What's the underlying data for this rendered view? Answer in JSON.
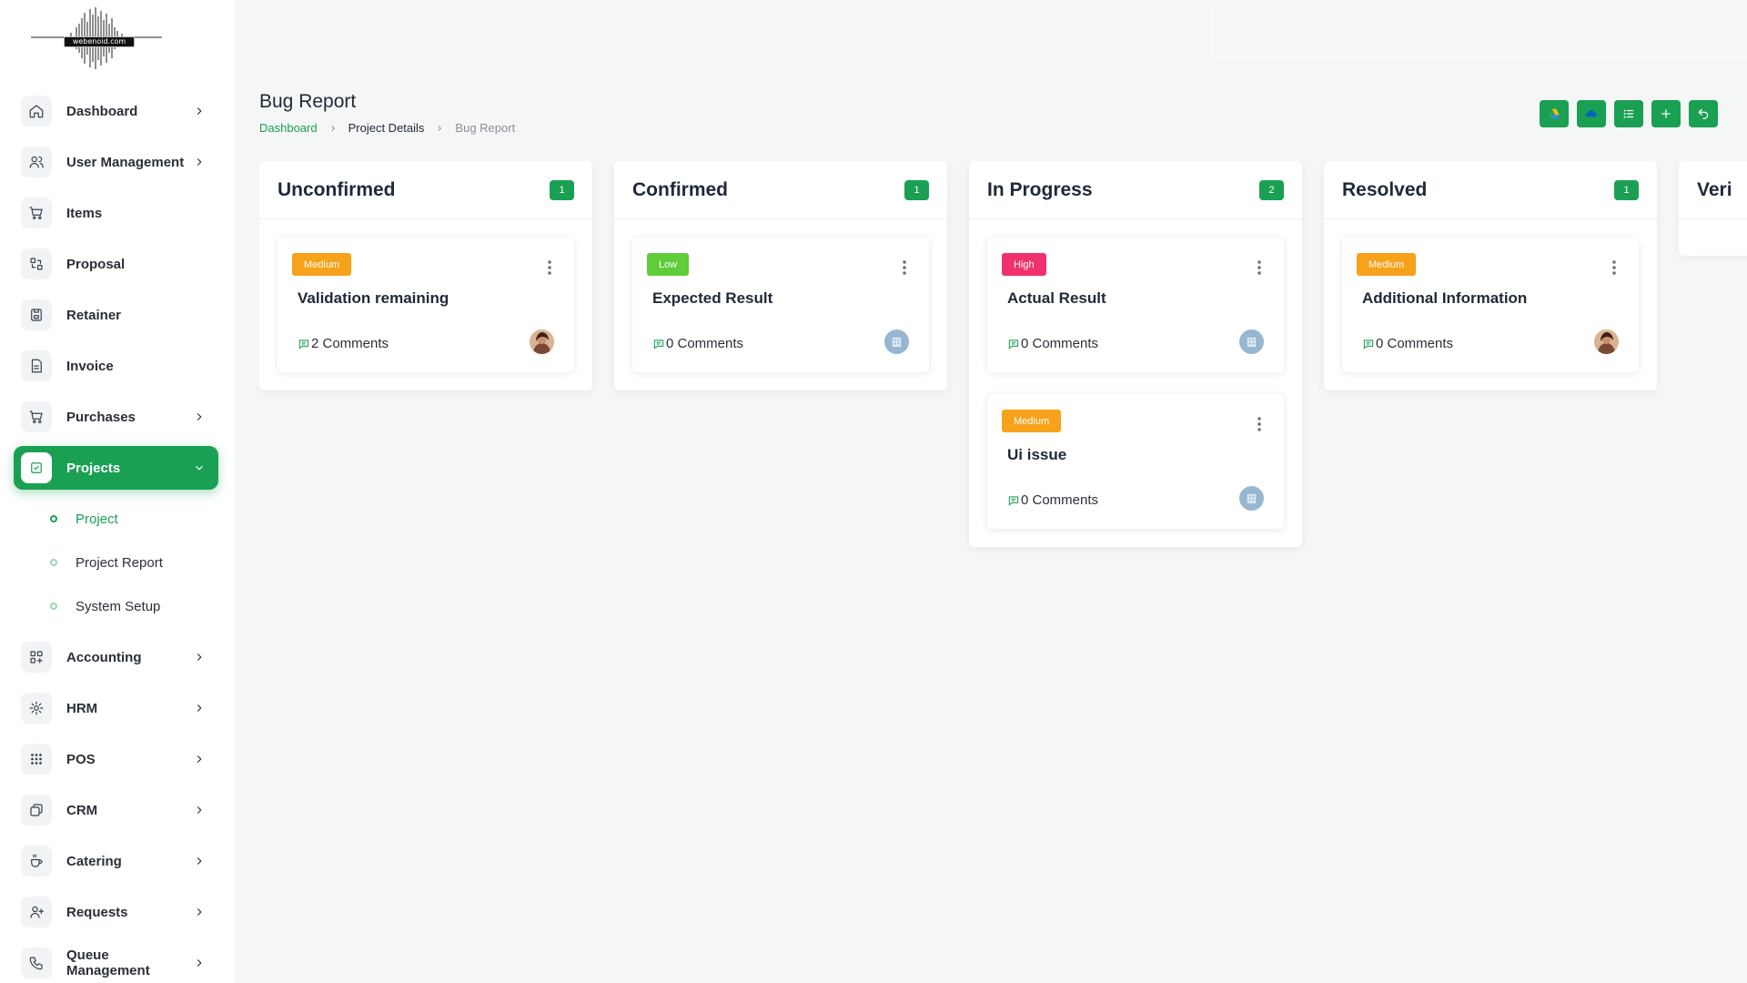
{
  "logo": {
    "text": "webenoid.com"
  },
  "sidebar": {
    "items": [
      {
        "label": "Dashboard",
        "icon": "home-icon",
        "has_chevron": true
      },
      {
        "label": "User Management",
        "icon": "users-icon",
        "has_chevron": true
      },
      {
        "label": "Items",
        "icon": "cart-icon",
        "has_chevron": false
      },
      {
        "label": "Proposal",
        "icon": "proposal-icon",
        "has_chevron": false
      },
      {
        "label": "Retainer",
        "icon": "save-icon",
        "has_chevron": false
      },
      {
        "label": "Invoice",
        "icon": "document-icon",
        "has_chevron": false
      },
      {
        "label": "Purchases",
        "icon": "cart-icon",
        "has_chevron": true
      },
      {
        "label": "Projects",
        "icon": "check-square-icon",
        "has_chevron": true,
        "active": true
      },
      {
        "label": "Accounting",
        "icon": "grid-icon",
        "has_chevron": true
      },
      {
        "label": "HRM",
        "icon": "hrm-icon",
        "has_chevron": true
      },
      {
        "label": "POS",
        "icon": "dots-grid-icon",
        "has_chevron": true
      },
      {
        "label": "CRM",
        "icon": "crm-icon",
        "has_chevron": true
      },
      {
        "label": "Catering",
        "icon": "coffee-icon",
        "has_chevron": true
      },
      {
        "label": "Requests",
        "icon": "user-plus-icon",
        "has_chevron": true
      },
      {
        "label": "Queue Management",
        "icon": "phone-icon",
        "has_chevron": true
      }
    ],
    "projects_sub": [
      {
        "label": "Project",
        "current": true
      },
      {
        "label": "Project Report"
      },
      {
        "label": "System Setup"
      }
    ]
  },
  "header": {
    "title": "Bug Report",
    "breadcrumb": [
      "Dashboard",
      "Project Details",
      "Bug Report"
    ],
    "actions": [
      "google-drive-icon",
      "onedrive-icon",
      "list-icon",
      "plus-icon",
      "back-icon"
    ]
  },
  "board": {
    "columns": [
      {
        "title": "Unconfirmed",
        "count": "1",
        "cards": [
          {
            "priority": "Medium",
            "title": "Validation remaining",
            "comments": "2 Comments",
            "avatar": "photo"
          }
        ]
      },
      {
        "title": "Confirmed",
        "count": "1",
        "cards": [
          {
            "priority": "Low",
            "title": "Expected Result",
            "comments": "0 Comments",
            "avatar": "building"
          }
        ]
      },
      {
        "title": "In Progress",
        "count": "2",
        "cards": [
          {
            "priority": "High",
            "title": "Actual Result",
            "comments": "0 Comments",
            "avatar": "building"
          },
          {
            "priority": "Medium",
            "title": "Ui issue",
            "comments": "0 Comments",
            "avatar": "building"
          }
        ]
      },
      {
        "title": "Resolved",
        "count": "1",
        "cards": [
          {
            "priority": "Medium",
            "title": "Additional Information",
            "comments": "0 Comments",
            "avatar": "photo"
          }
        ]
      },
      {
        "title": "Veri",
        "count": "",
        "cards": []
      }
    ]
  },
  "colors": {
    "accent": "#1aa053",
    "medium": "#f7a21b",
    "low": "#5fcd3a",
    "high": "#f0326c"
  }
}
